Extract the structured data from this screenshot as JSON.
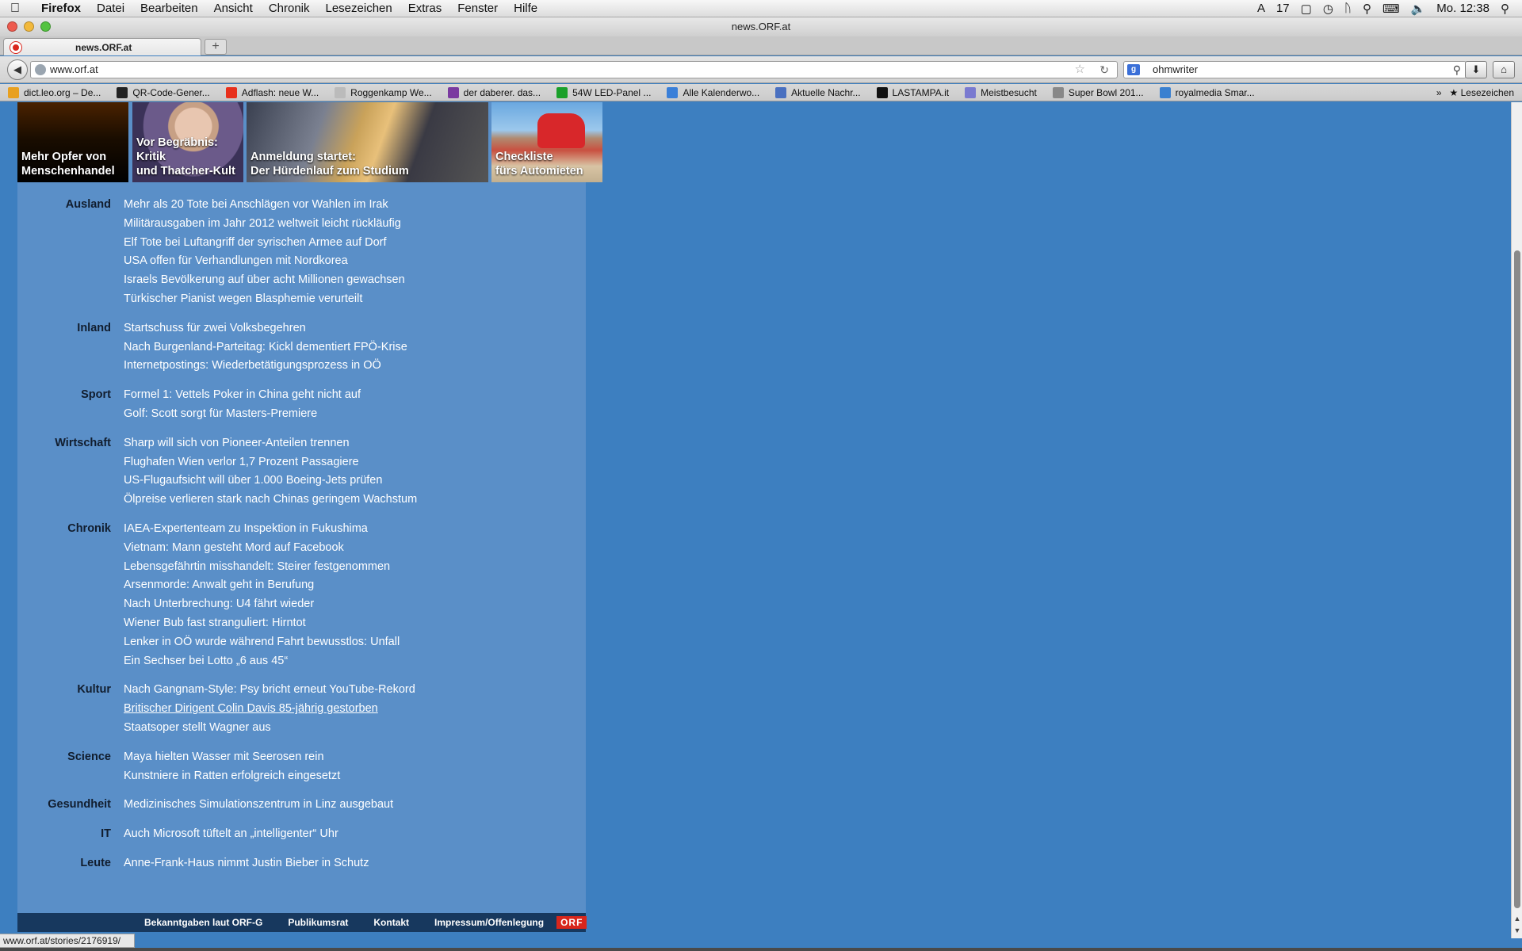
{
  "menubar": {
    "app": "Firefox",
    "items": [
      "Datei",
      "Bearbeiten",
      "Ansicht",
      "Chronik",
      "Lesezeichen",
      "Extras",
      "Fenster",
      "Hilfe"
    ],
    "status_badge": "17",
    "clock": "Mo. 12:38"
  },
  "window": {
    "title": "news.ORF.at"
  },
  "tab": {
    "label": "news.ORF.at",
    "newtab": "+"
  },
  "nav": {
    "url": "www.orf.at",
    "search_value": "ohmwriter"
  },
  "bookmarks": {
    "items": [
      {
        "label": "dict.leo.org – De...",
        "icon": "leo-icon",
        "color": "#e8a020"
      },
      {
        "label": "QR-Code-Gener...",
        "icon": "qr-icon",
        "color": "#222222"
      },
      {
        "label": "Adflash: neue W...",
        "icon": "adflash-icon",
        "color": "#e8301c"
      },
      {
        "label": "Roggenkamp We...",
        "icon": "page-icon",
        "color": "#bbbbbb"
      },
      {
        "label": "der daberer. das...",
        "icon": "grape-icon",
        "color": "#7a3aa0"
      },
      {
        "label": "54W LED-Panel ...",
        "icon": "led-icon",
        "color": "#1aa02a"
      },
      {
        "label": "Alle Kalenderwo...",
        "icon": "kw-icon",
        "color": "#3a7fd8"
      },
      {
        "label": "Aktuelle Nachr...",
        "icon": "rss-icon",
        "color": "#4a70c0"
      },
      {
        "label": "LASTAMPA.it",
        "icon": "lastampa-icon",
        "color": "#111111"
      },
      {
        "label": "Meistbesucht",
        "icon": "folder-icon",
        "color": "#7a7ad0"
      },
      {
        "label": "Super Bowl 201...",
        "icon": "globe-icon",
        "color": "#888888"
      },
      {
        "label": "royalmedia Smar...",
        "icon": "dots-icon",
        "color": "#3a80d0"
      }
    ],
    "overflow": "»",
    "folder": "Lesezeichen"
  },
  "teasers": [
    "Mehr Opfer von\nMenschenhandel",
    "Vor Begräbnis: Kritik\nund Thatcher-Kult",
    "Anmeldung startet:\nDer Hürdenlauf zum Studium",
    "Checkliste\nfürs Automieten"
  ],
  "sections": [
    {
      "label": "Ausland",
      "items": [
        "Mehr als 20 Tote bei Anschlägen vor Wahlen im Irak",
        "Militärausgaben im Jahr 2012 weltweit leicht rückläufig",
        "Elf Tote bei Luftangriff der syrischen Armee auf Dorf",
        "USA offen für Verhandlungen mit Nordkorea",
        "Israels Bevölkerung auf über acht Millionen gewachsen",
        "Türkischer Pianist wegen Blasphemie verurteilt"
      ]
    },
    {
      "label": "Inland",
      "items": [
        "Startschuss für zwei Volksbegehren",
        "Nach Burgenland-Parteitag: Kickl dementiert FPÖ-Krise",
        "Internetpostings: Wiederbetätigungsprozess in OÖ"
      ]
    },
    {
      "label": "Sport",
      "items": [
        "Formel 1: Vettels Poker in China geht nicht auf",
        "Golf: Scott sorgt für Masters-Premiere"
      ]
    },
    {
      "label": "Wirtschaft",
      "items": [
        "Sharp will sich von Pioneer-Anteilen trennen",
        "Flughafen Wien verlor 1,7 Prozent Passagiere",
        "US-Flugaufsicht will über 1.000 Boeing-Jets prüfen",
        "Ölpreise verlieren stark nach Chinas geringem Wachstum"
      ]
    },
    {
      "label": "Chronik",
      "items": [
        "IAEA-Expertenteam zu Inspektion in Fukushima",
        "Vietnam: Mann gesteht Mord auf Facebook",
        "Lebensgefährtin misshandelt: Steirer festgenommen",
        "Arsenmorde: Anwalt geht in Berufung",
        "Nach Unterbrechung: U4 fährt wieder",
        "Wiener Bub fast stranguliert: Hirntot",
        "Lenker in OÖ wurde während Fahrt bewusstlos: Unfall",
        "Ein Sechser bei Lotto „6 aus 45“"
      ]
    },
    {
      "label": "Kultur",
      "items": [
        "Nach Gangnam-Style: Psy bricht erneut YouTube-Rekord",
        "Britischer Dirigent Colin Davis 85-jährig gestorben",
        "Staatsoper stellt Wagner aus"
      ],
      "hover_index": 1
    },
    {
      "label": "Science",
      "items": [
        "Maya hielten Wasser mit Seerosen rein",
        "Kunstniere in Ratten erfolgreich eingesetzt"
      ]
    },
    {
      "label": "Gesundheit",
      "items": [
        "Medizinisches Simulationszentrum in Linz ausgebaut"
      ]
    },
    {
      "label": "IT",
      "items": [
        "Auch Microsoft tüftelt an „intelligenter“ Uhr"
      ]
    },
    {
      "label": "Leute",
      "items": [
        "Anne-Frank-Haus nimmt Justin Bieber in Schutz"
      ]
    }
  ],
  "footer": {
    "links": [
      "Bekanntgaben laut ORF-G",
      "Publikumsrat",
      "Kontakt",
      "Impressum/Offenlegung"
    ],
    "logo": "ORF"
  },
  "statusbar": {
    "url": "www.orf.at/stories/2176919/"
  },
  "colors": {
    "page_bg": "#3d7fc0",
    "content_bg": "#5a8fc8",
    "footer_bg": "#17385e",
    "orf_red": "#d8261c"
  }
}
